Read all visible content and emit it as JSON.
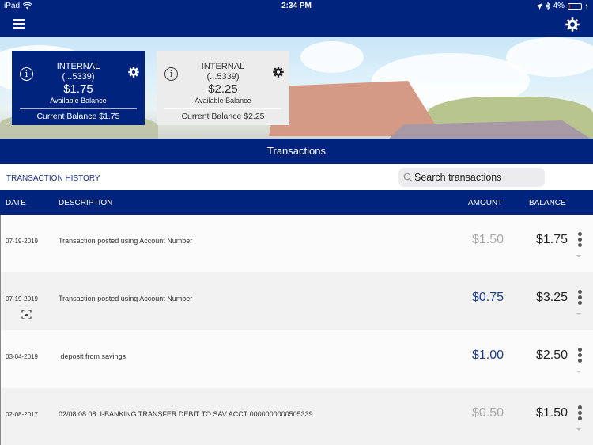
{
  "status_bar": {
    "device": "iPad",
    "time": "2:34 PM",
    "battery": "4%",
    "battery_level": 0.04
  },
  "nav": {
    "menu_icon": "hamburger-menu-icon",
    "settings_icon": "gear-icon"
  },
  "accounts": [
    {
      "name": "INTERNAL",
      "number": "(...5339)",
      "available_balance": "$1.75",
      "available_label": "Available Balance",
      "current_balance": "Current Balance $1.75",
      "selected": true
    },
    {
      "name": "INTERNAL",
      "number": "(...5339)",
      "available_balance": "$2.25",
      "available_label": "Available Balance",
      "current_balance": "Current Balance $2.25",
      "selected": false
    }
  ],
  "transactions_section": {
    "title": "Transactions",
    "history_label": "TRANSACTION HISTORY",
    "search_placeholder": "Search transactions"
  },
  "columns": {
    "date": "DATE",
    "description": "DESCRIPTION",
    "amount": "AMOUNT",
    "balance": "BALANCE"
  },
  "rows": [
    {
      "date": "07-19-2019",
      "description": "Transaction posted using Account Number",
      "amount": "$1.50",
      "amount_status": "pending",
      "balance": "$1.75",
      "has_scan_icon": false
    },
    {
      "date": "07-19-2019",
      "description": "Transaction posted using Account Number",
      "amount": "$0.75",
      "amount_status": "posted",
      "balance": "$3.25",
      "has_scan_icon": true
    },
    {
      "date": "03-04-2019",
      "description": " deposit from savings",
      "amount": "$1.00",
      "amount_status": "posted",
      "balance": "$2.50",
      "has_scan_icon": false
    },
    {
      "date": "02-08-2017",
      "description": "02/08 08:08  I-BANKING TRANSFER DEBIT TO SAV ACCT 0000000000505339",
      "amount": "$0.50",
      "amount_status": "pending",
      "balance": "$1.50",
      "has_scan_icon": false
    }
  ],
  "colors": {
    "brand_navy": "#00247d",
    "posted_amount": "#1a3d8f",
    "pending_amount": "#a9a9a9"
  }
}
